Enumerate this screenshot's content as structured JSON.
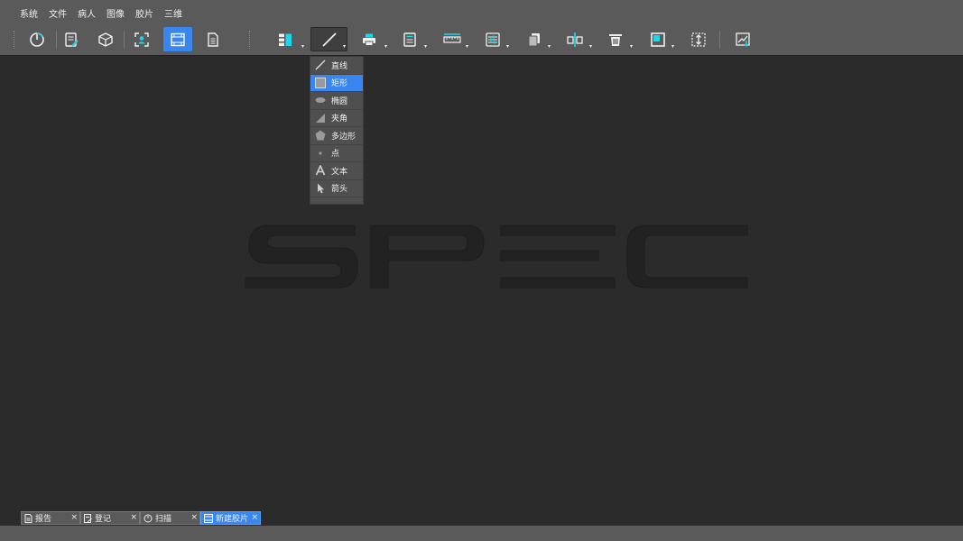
{
  "menu": [
    "系统",
    "文件",
    "病人",
    "图像",
    "胶片",
    "三维"
  ],
  "toolbar": {
    "buttons": [
      {
        "name": "timer-icon"
      },
      {
        "name": "edit-document-icon"
      },
      {
        "name": "cube-icon"
      },
      {
        "name": "user-frame-icon"
      },
      {
        "name": "film-icon",
        "active": true
      },
      {
        "name": "document-icon"
      },
      {
        "name": "layout-icon"
      },
      {
        "name": "line-tool-icon",
        "pressed": true
      },
      {
        "name": "printer-icon"
      },
      {
        "name": "text-tool-icon"
      },
      {
        "name": "ruler-icon"
      },
      {
        "name": "sliders-icon"
      },
      {
        "name": "copy-icon"
      },
      {
        "name": "flip-icon"
      },
      {
        "name": "trash-icon"
      },
      {
        "name": "window-icon"
      },
      {
        "name": "image-size-icon"
      },
      {
        "name": "chart-export-icon"
      }
    ]
  },
  "dropdown": {
    "items": [
      {
        "label": "直线",
        "icon": "line-icon"
      },
      {
        "label": "矩形",
        "icon": "rectangle-icon",
        "selected": true
      },
      {
        "label": "椭圆",
        "icon": "ellipse-icon"
      },
      {
        "label": "夹角",
        "icon": "angle-icon"
      },
      {
        "label": "多边形",
        "icon": "polygon-icon"
      },
      {
        "label": "点",
        "icon": "point-icon"
      },
      {
        "label": "文本",
        "icon": "text-icon"
      },
      {
        "label": "箭头",
        "icon": "arrow-icon"
      }
    ]
  },
  "logo_text": "SPEC",
  "tabs": [
    {
      "label": "报告",
      "icon": "report-icon"
    },
    {
      "label": "登记",
      "icon": "register-icon"
    },
    {
      "label": "扫描",
      "icon": "scan-icon"
    },
    {
      "label": "新建胶片",
      "icon": "film-tab-icon",
      "active": true
    }
  ],
  "tab_close": "×",
  "caret": "▾",
  "colors": {
    "accent": "#3a86f0",
    "bar": "#5a5a5a",
    "workspace": "#2b2b2b",
    "icon_cyan": "#18d8f0"
  }
}
